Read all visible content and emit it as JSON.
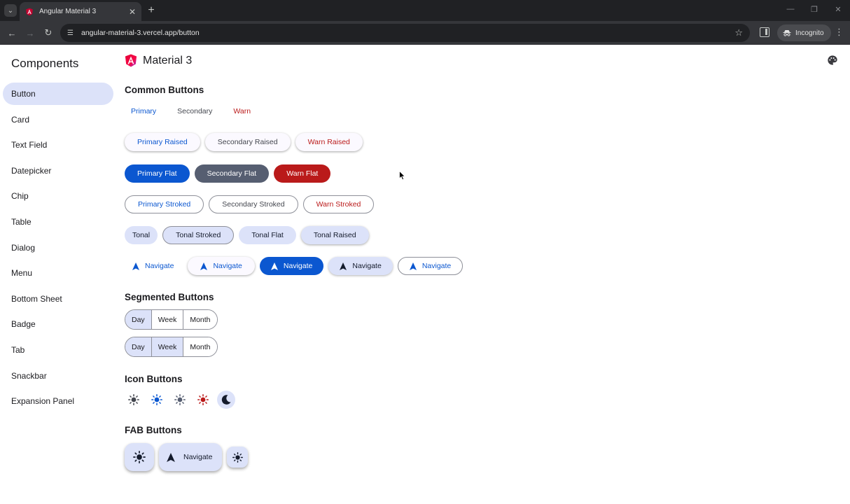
{
  "browser": {
    "tab_title": "Angular Material 3",
    "url": "angular-material-3.vercel.app/button",
    "incognito_label": "Incognito",
    "icons": [
      "tab-search-icon",
      "close-icon",
      "plus-icon",
      "back-icon",
      "forward-icon",
      "reload-icon",
      "site-info-icon",
      "star-icon",
      "side-panel-icon",
      "incognito-icon",
      "kebab-menu-icon",
      "minimize-icon",
      "restore-icon",
      "window-close-icon"
    ]
  },
  "sidebar": {
    "title": "Components",
    "items": [
      {
        "label": "Button",
        "active": true
      },
      {
        "label": "Card"
      },
      {
        "label": "Text Field"
      },
      {
        "label": "Datepicker"
      },
      {
        "label": "Chip"
      },
      {
        "label": "Table"
      },
      {
        "label": "Dialog"
      },
      {
        "label": "Menu"
      },
      {
        "label": "Bottom Sheet"
      },
      {
        "label": "Badge"
      },
      {
        "label": "Tab"
      },
      {
        "label": "Snackbar"
      },
      {
        "label": "Expansion Panel"
      }
    ]
  },
  "header": {
    "title": "Material 3",
    "logo_icon": "angular-logo-icon",
    "theme_icon": "palette-icon"
  },
  "colors": {
    "primary": "#0b57d0",
    "secondary": "#565e71",
    "warn": "#ba1a1a",
    "tonal": "#dce2f9",
    "active_nav": "#dce2f9"
  },
  "common": {
    "title": "Common Buttons",
    "text": [
      "Primary",
      "Secondary",
      "Warn"
    ],
    "raised": [
      "Primary Raised",
      "Secondary Raised",
      "Warn Raised"
    ],
    "flat": [
      "Primary Flat",
      "Secondary Flat",
      "Warn Flat"
    ],
    "stroked": [
      "Primary Stroked",
      "Secondary Stroked",
      "Warn Stroked"
    ],
    "tonal": [
      "Tonal",
      "Tonal Stroked",
      "Tonal Flat",
      "Tonal Raised"
    ],
    "navigate": [
      "Navigate",
      "Navigate",
      "Navigate",
      "Navigate",
      "Navigate"
    ]
  },
  "segmented": {
    "title": "Segmented Buttons",
    "groups": [
      {
        "options": [
          "Day",
          "Week",
          "Month"
        ],
        "selected": [
          "Day"
        ]
      },
      {
        "options": [
          "Day",
          "Week",
          "Month"
        ],
        "selected": [
          "Day",
          "Week"
        ]
      }
    ]
  },
  "icon_buttons": {
    "title": "Icon Buttons",
    "icons": [
      "sun-icon",
      "sun-icon",
      "sun-icon",
      "sun-icon",
      "moon-icon"
    ]
  },
  "fab": {
    "title": "FAB Buttons",
    "extended_label": "Navigate",
    "icons": [
      "sun-icon",
      "navigation-arrow-icon",
      "sun-icon"
    ]
  }
}
